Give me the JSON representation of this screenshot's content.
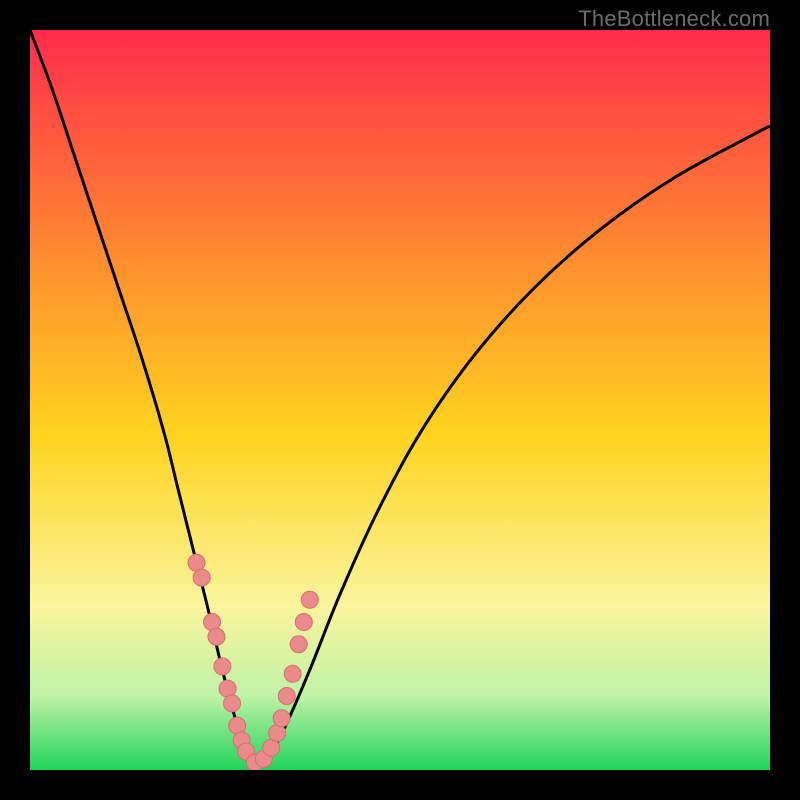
{
  "attribution": "TheBottleneck.com",
  "colors": {
    "top_red": "#ff2b4c",
    "mid_orange": "#ff8a30",
    "mid_yellow": "#ffd41f",
    "pale_yellow": "#faf59e",
    "pale_green": "#bff3a6",
    "green": "#1fd45a",
    "curve": "#000000",
    "marker_fill": "#ea8a8a",
    "marker_stroke": "#d66f6f",
    "frame": "#000000"
  },
  "chart_data": {
    "type": "line",
    "title": "",
    "xlabel": "",
    "ylabel": "",
    "xlim": [
      0,
      100
    ],
    "ylim": [
      0,
      100
    ],
    "series": [
      {
        "name": "bottleneck-curve",
        "x": [
          0,
          3,
          6,
          9,
          12,
          15,
          18,
          20,
          22,
          24,
          26,
          28,
          29,
          30,
          30.5,
          31.5,
          33,
          35,
          38,
          42,
          47,
          53,
          60,
          68,
          77,
          87,
          98,
          100
        ],
        "y": [
          100,
          92,
          83,
          74,
          65,
          56,
          46,
          38,
          30,
          22,
          13.5,
          6,
          3,
          1,
          0.6,
          1,
          3,
          7,
          14,
          24,
          35,
          46,
          56,
          65,
          73,
          80,
          86,
          87
        ]
      }
    ],
    "markers": {
      "name": "highlighted-points",
      "x": [
        22.5,
        23.2,
        24.6,
        25.2,
        26.0,
        26.7,
        27.3,
        28.0,
        28.6,
        29.2,
        30.4,
        31.6,
        32.6,
        33.4,
        34.0,
        34.7,
        35.5,
        36.3,
        37.0,
        37.8
      ],
      "y": [
        28,
        26,
        20,
        18,
        14,
        11,
        9,
        6,
        4,
        2.5,
        1,
        1.5,
        3,
        5,
        7,
        10,
        13,
        17,
        20,
        23
      ]
    }
  }
}
